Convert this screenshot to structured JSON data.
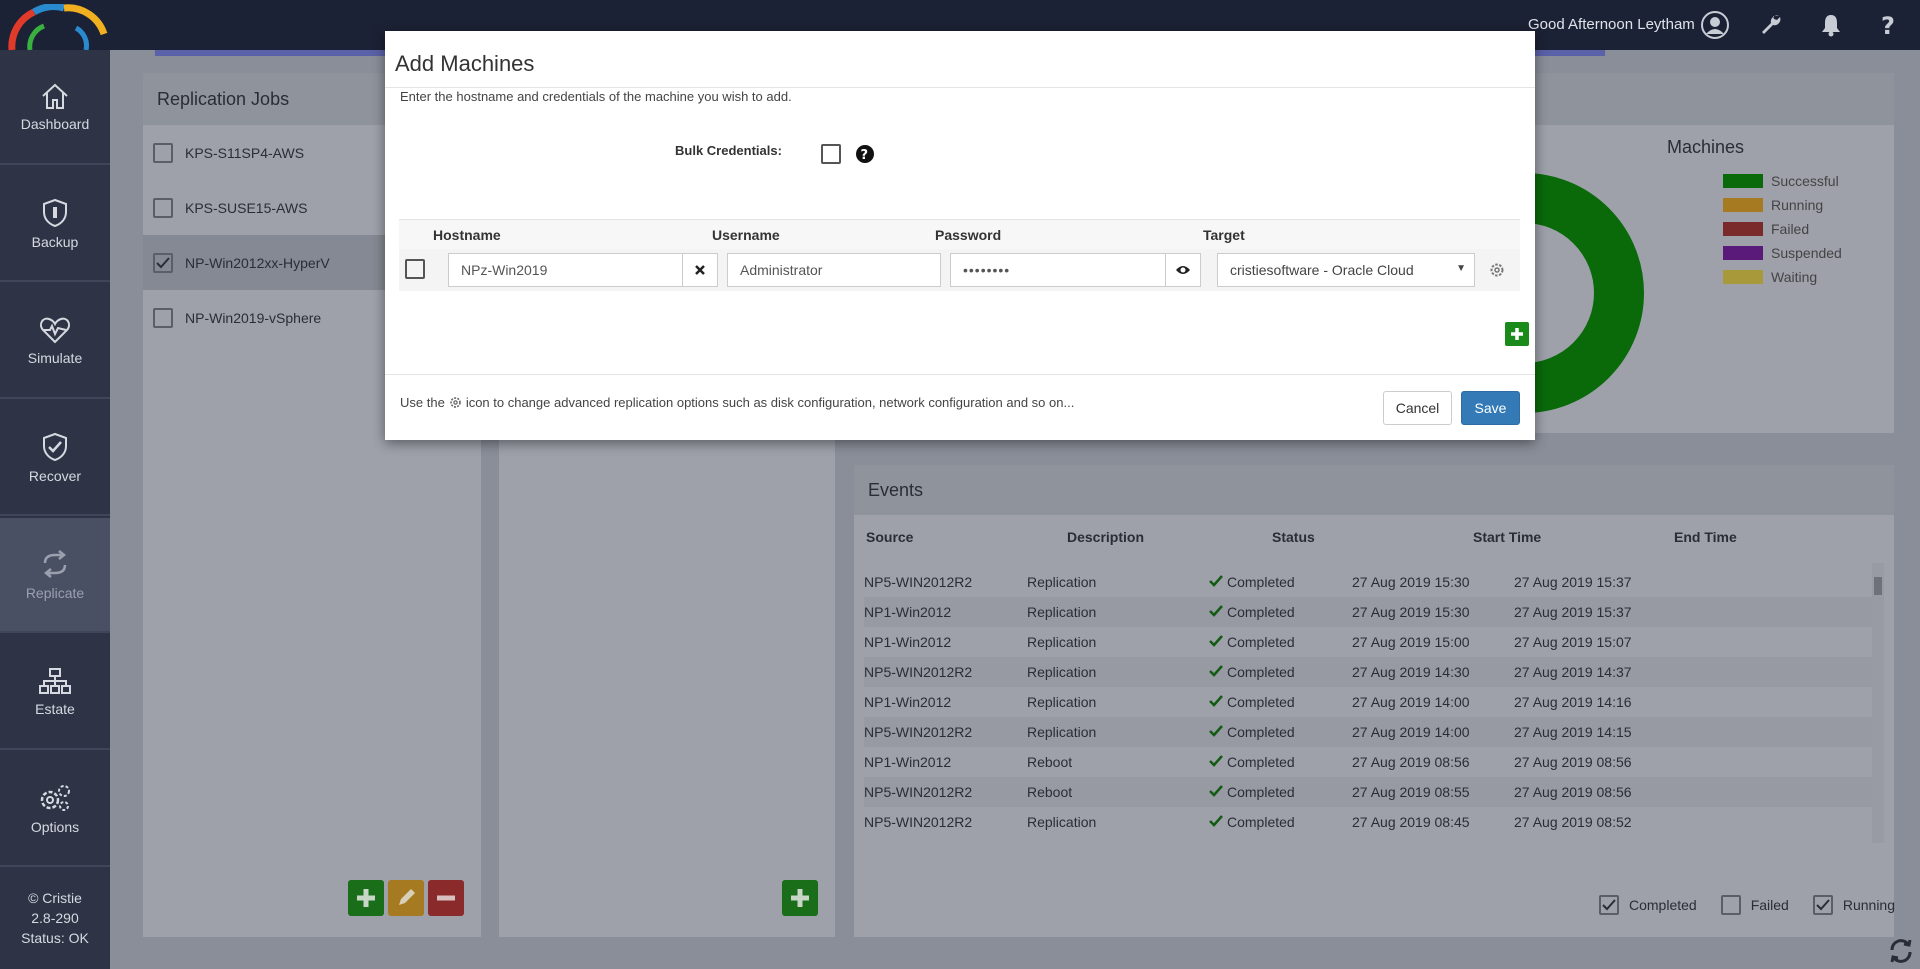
{
  "header": {
    "greeting": "Good Afternoon Leytham"
  },
  "sidebar": {
    "items": [
      {
        "label": "Dashboard",
        "icon": "home-icon"
      },
      {
        "label": "Backup",
        "icon": "shield-icon"
      },
      {
        "label": "Simulate",
        "icon": "heartbeat-icon"
      },
      {
        "label": "Recover",
        "icon": "shield-check-icon"
      },
      {
        "label": "Replicate",
        "icon": "replicate-icon"
      },
      {
        "label": "Estate",
        "icon": "hierarchy-icon"
      },
      {
        "label": "Options",
        "icon": "gears-icon"
      }
    ],
    "active": "Replicate",
    "copyright": "© Cristie",
    "version": "2.8-290",
    "status": "Status: OK"
  },
  "replication_jobs": {
    "title": "Replication Jobs",
    "jobs": [
      {
        "name": "KPS-S11SP4-AWS",
        "checked": false
      },
      {
        "name": "KPS-SUSE15-AWS",
        "checked": false
      },
      {
        "name": "NP-Win2012xx-HyperV",
        "checked": true
      },
      {
        "name": "NP-Win2019-vSphere",
        "checked": false
      }
    ]
  },
  "machines_chart": {
    "title": "Machines",
    "legend": [
      {
        "label": "Successful",
        "color": "#0a7a0a"
      },
      {
        "label": "Running",
        "color": "#c98a20"
      },
      {
        "label": "Failed",
        "color": "#8a2a2a"
      },
      {
        "label": "Suspended",
        "color": "#6a1a8a"
      },
      {
        "label": "Waiting",
        "color": "#bfae3a"
      }
    ]
  },
  "events": {
    "title": "Events",
    "columns": [
      "Source",
      "Description",
      "Status",
      "Start Time",
      "End Time"
    ],
    "rows": [
      {
        "source": "NP5-WIN2012R2",
        "description": "Replication",
        "status": "Completed",
        "start": "27 Aug 2019 15:30",
        "end": "27 Aug 2019 15:37"
      },
      {
        "source": "NP1-Win2012",
        "description": "Replication",
        "status": "Completed",
        "start": "27 Aug 2019 15:30",
        "end": "27 Aug 2019 15:37"
      },
      {
        "source": "NP1-Win2012",
        "description": "Replication",
        "status": "Completed",
        "start": "27 Aug 2019 15:00",
        "end": "27 Aug 2019 15:07"
      },
      {
        "source": "NP5-WIN2012R2",
        "description": "Replication",
        "status": "Completed",
        "start": "27 Aug 2019 14:30",
        "end": "27 Aug 2019 14:37"
      },
      {
        "source": "NP1-Win2012",
        "description": "Replication",
        "status": "Completed",
        "start": "27 Aug 2019 14:00",
        "end": "27 Aug 2019 14:16"
      },
      {
        "source": "NP5-WIN2012R2",
        "description": "Replication",
        "status": "Completed",
        "start": "27 Aug 2019 14:00",
        "end": "27 Aug 2019 14:15"
      },
      {
        "source": "NP1-Win2012",
        "description": "Reboot",
        "status": "Completed",
        "start": "27 Aug 2019 08:56",
        "end": "27 Aug 2019 08:56"
      },
      {
        "source": "NP5-WIN2012R2",
        "description": "Reboot",
        "status": "Completed",
        "start": "27 Aug 2019 08:55",
        "end": "27 Aug 2019 08:56"
      },
      {
        "source": "NP5-WIN2012R2",
        "description": "Replication",
        "status": "Completed",
        "start": "27 Aug 2019 08:45",
        "end": "27 Aug 2019 08:52"
      }
    ],
    "filters": [
      {
        "label": "Completed",
        "checked": true
      },
      {
        "label": "Failed",
        "checked": false
      },
      {
        "label": "Running",
        "checked": true
      }
    ]
  },
  "modal": {
    "title": "Add Machines",
    "description": "Enter the hostname and credentials of the machine you wish to add.",
    "bulk_label": "Bulk Credentials:",
    "columns": {
      "hostname": "Hostname",
      "username": "Username",
      "password": "Password",
      "target": "Target"
    },
    "row": {
      "hostname": "NPz-Win2019",
      "username": "Administrator",
      "password": "••••••••",
      "target": "cristiesoftware - Oracle Cloud"
    },
    "footer_pre": "Use the",
    "footer_post": "icon to change advanced replication options such as disk configuration, network configuration and so on...",
    "cancel": "Cancel",
    "save": "Save"
  }
}
